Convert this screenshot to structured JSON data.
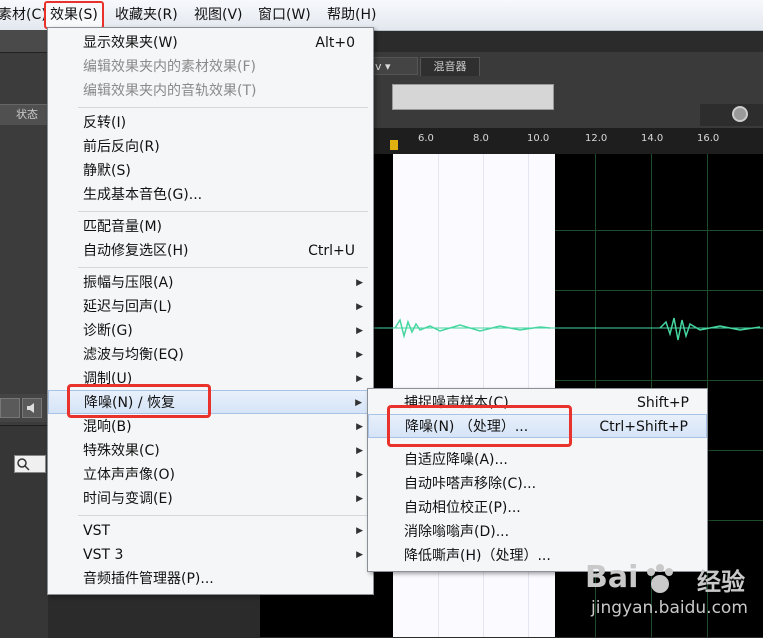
{
  "menubar": {
    "items": [
      "素材(C)",
      "效果(S)",
      "收藏夹(R)",
      "视图(V)",
      "窗口(W)",
      "帮助(H)"
    ]
  },
  "left_panel": {
    "status_label": "状态"
  },
  "editor": {
    "mixer_tab": "混音器",
    "v_tab": "v",
    "ruler_ticks": [
      "6.0",
      "8.0",
      "10.0",
      "12.0",
      "14.0",
      "16.0"
    ]
  },
  "effects_menu": {
    "items": [
      {
        "label": "显示效果夹(W)",
        "shortcut": "Alt+0"
      },
      {
        "label": "编辑效果夹内的素材效果(F)",
        "disabled": true
      },
      {
        "label": "编辑效果夹内的音轨效果(T)",
        "disabled": true
      },
      {
        "label": "反转(I)"
      },
      {
        "label": "前后反向(R)"
      },
      {
        "label": "静默(S)"
      },
      {
        "label": "生成基本音色(G)..."
      },
      {
        "label": "匹配音量(M)"
      },
      {
        "label": "自动修复选区(H)",
        "shortcut": "Ctrl+U"
      },
      {
        "label": "振幅与压限(A)",
        "submenu": true
      },
      {
        "label": "延迟与回声(L)",
        "submenu": true
      },
      {
        "label": "诊断(G)",
        "submenu": true
      },
      {
        "label": "滤波与均衡(EQ)",
        "submenu": true
      },
      {
        "label": "调制(U)",
        "submenu": true
      },
      {
        "label": "降噪(N) / 恢复",
        "submenu": true
      },
      {
        "label": "混响(B)",
        "submenu": true
      },
      {
        "label": "特殊效果(C)",
        "submenu": true
      },
      {
        "label": "立体声声像(O)",
        "submenu": true
      },
      {
        "label": "时间与变调(E)",
        "submenu": true
      },
      {
        "label": "VST",
        "submenu": true
      },
      {
        "label": "VST 3",
        "submenu": true
      },
      {
        "label": "音频插件管理器(P)..."
      }
    ]
  },
  "noise_submenu": {
    "items": [
      {
        "label": "捕捉噪声样本(C)",
        "shortcut": "Shift+P"
      },
      {
        "label": "降噪(N) （处理）...",
        "shortcut": "Ctrl+Shift+P"
      },
      {
        "label": "自适应降噪(A)..."
      },
      {
        "label": "自动咔嗒声移除(C)..."
      },
      {
        "label": "自动相位校正(P)..."
      },
      {
        "label": "消除嗡嗡声(D)..."
      },
      {
        "label": "降低嘶声(H)（处理）..."
      }
    ]
  },
  "watermark": {
    "brand": "Bai",
    "sub": "经验",
    "url": "jingyan.baidu.com"
  },
  "colors": {
    "highlight_box": "#e8322b",
    "menu_hover": "#d5e4f7",
    "waveform": "#46d6a0"
  }
}
